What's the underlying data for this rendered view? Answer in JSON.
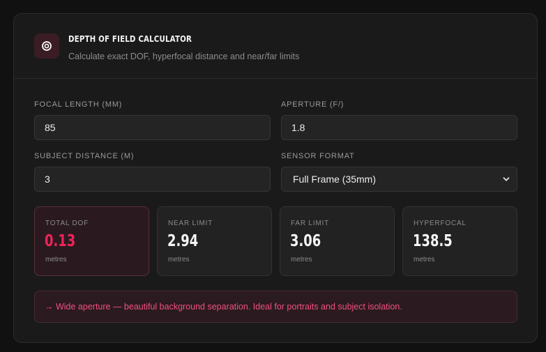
{
  "header": {
    "icon": "aperture-icon",
    "title": "DEPTH OF FIELD CALCULATOR",
    "subtitle": "Calculate exact DOF, hyperfocal distance and near/far limits"
  },
  "form": {
    "focal_length": {
      "label": "FOCAL LENGTH (MM)",
      "value": "85"
    },
    "aperture": {
      "label": "APERTURE (F/)",
      "value": "1.8"
    },
    "subject_distance": {
      "label": "SUBJECT DISTANCE (M)",
      "value": "3"
    },
    "sensor_format": {
      "label": "SENSOR FORMAT",
      "value": "Full Frame (35mm)"
    }
  },
  "results": [
    {
      "label": "TOTAL DOF",
      "value": "0.13",
      "unit": "metres"
    },
    {
      "label": "NEAR LIMIT",
      "value": "2.94",
      "unit": "metres"
    },
    {
      "label": "FAR LIMIT",
      "value": "3.06",
      "unit": "metres"
    },
    {
      "label": "HYPERFOCAL",
      "value": "138.5",
      "unit": "metres"
    }
  ],
  "note": "→ Wide aperture — beautiful background separation. Ideal for portraits and subject isolation.",
  "colors": {
    "accent": "#f0245a",
    "note_text": "#f05080",
    "background": "#111111",
    "card": "#1a1a1a"
  }
}
